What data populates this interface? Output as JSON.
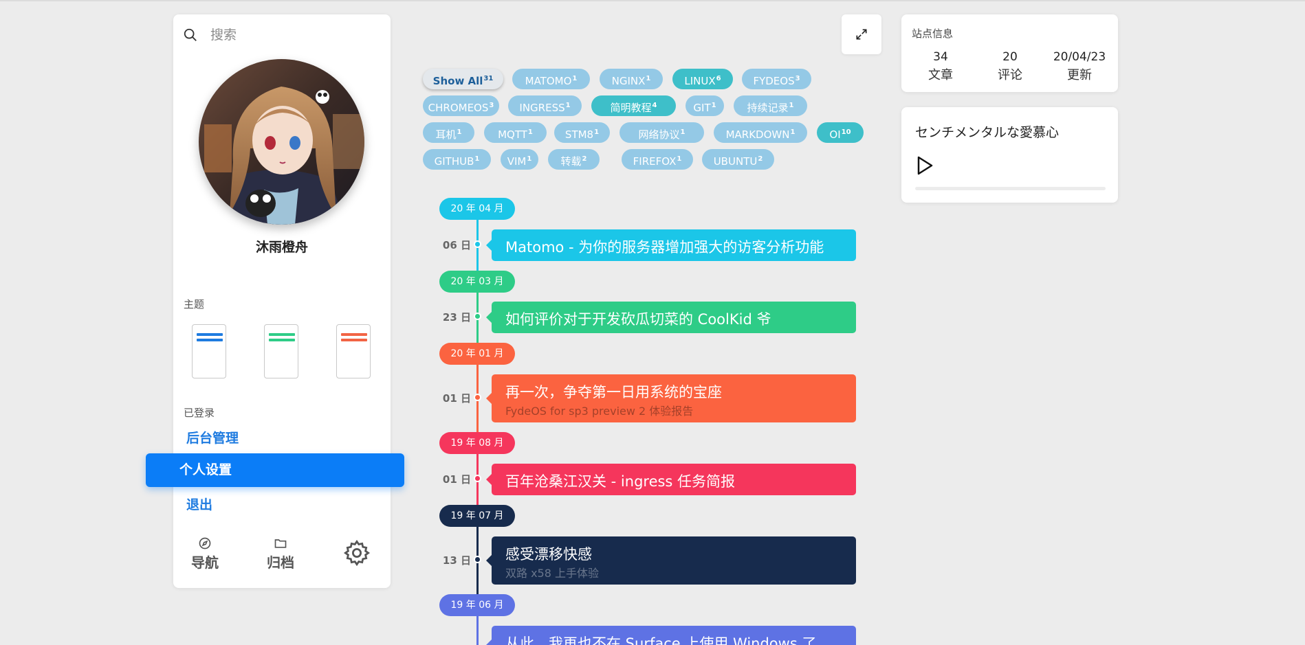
{
  "search": {
    "placeholder": "搜索"
  },
  "profile": {
    "name": "沐雨橙舟"
  },
  "theme": {
    "label": "主题",
    "colors": [
      "#1e7be0",
      "#2ecc87",
      "#f26444"
    ]
  },
  "account": {
    "label": "已登录",
    "links": [
      "后台管理",
      "个人设置",
      "退出"
    ],
    "active_index": 1
  },
  "bottom_nav": {
    "navigate": "导航",
    "archive": "归档"
  },
  "tags": [
    {
      "name": "Show All",
      "count": "31",
      "style": "active"
    },
    {
      "name": "MATOMO",
      "count": "1"
    },
    {
      "name": "NGINX",
      "count": "1"
    },
    {
      "name": "LINUX",
      "count": "6",
      "style": "teal"
    },
    {
      "name": "FYDEOS",
      "count": "3"
    },
    {
      "name": "CHROMEOS",
      "count": "3"
    },
    {
      "name": "INGRESS",
      "count": "1"
    },
    {
      "name": "简明教程",
      "count": "4",
      "style": "teal"
    },
    {
      "name": "GIT",
      "count": "1"
    },
    {
      "name": "持续记录",
      "count": "1"
    },
    {
      "name": "耳机",
      "count": "1"
    },
    {
      "name": "MQTT",
      "count": "1"
    },
    {
      "name": "STM8",
      "count": "1"
    },
    {
      "name": "网络协议",
      "count": "1"
    },
    {
      "name": "MARKDOWN",
      "count": "1"
    },
    {
      "name": "OI",
      "count": "10",
      "style": "teal"
    },
    {
      "name": "GITHUB",
      "count": "1"
    },
    {
      "name": "VIM",
      "count": "1"
    },
    {
      "name": "转载",
      "count": "2"
    },
    {
      "name": "FIREFOX",
      "count": "1"
    },
    {
      "name": "UBUNTU",
      "count": "2"
    }
  ],
  "timeline": [
    {
      "month": "20 年 04 月",
      "day": "06 日",
      "title": "Matomo - 为你的服务器增加强大的访客分析功能",
      "subtitle": "",
      "color": "#1bc6e8"
    },
    {
      "month": "20 年 03 月",
      "day": "23 日",
      "title": "如何评价对于开发砍瓜切菜的 CoolKid 爷",
      "subtitle": "",
      "color": "#2ecc87"
    },
    {
      "month": "20 年 01 月",
      "day": "01 日",
      "title": "再一次，争夺第一日用系统的宝座",
      "subtitle": "FydeOS for sp3 preview 2 体验报告",
      "color": "#fb6340"
    },
    {
      "month": "19 年 08 月",
      "day": "01 日",
      "title": "百年沧桑江汉关 - ingress 任务简报",
      "subtitle": "",
      "color": "#f5365c"
    },
    {
      "month": "19 年 07 月",
      "day": "13 日",
      "title": "感受漂移快感",
      "subtitle": "双路 x58 上手体验",
      "color": "#172b4d"
    },
    {
      "month": "19 年 06 月",
      "day": "",
      "title": "从此，我再也不在 Surface 上使用 Windows 了",
      "subtitle": "",
      "color": "#5e72e4"
    }
  ],
  "site_info": {
    "title": "站点信息",
    "stats": [
      {
        "value": "34",
        "label": "文章"
      },
      {
        "value": "20",
        "label": "评论"
      },
      {
        "value": "20/04/23",
        "label": "更新"
      }
    ]
  },
  "music": {
    "title": "センチメンタルな愛慕心",
    "progress": 0
  }
}
